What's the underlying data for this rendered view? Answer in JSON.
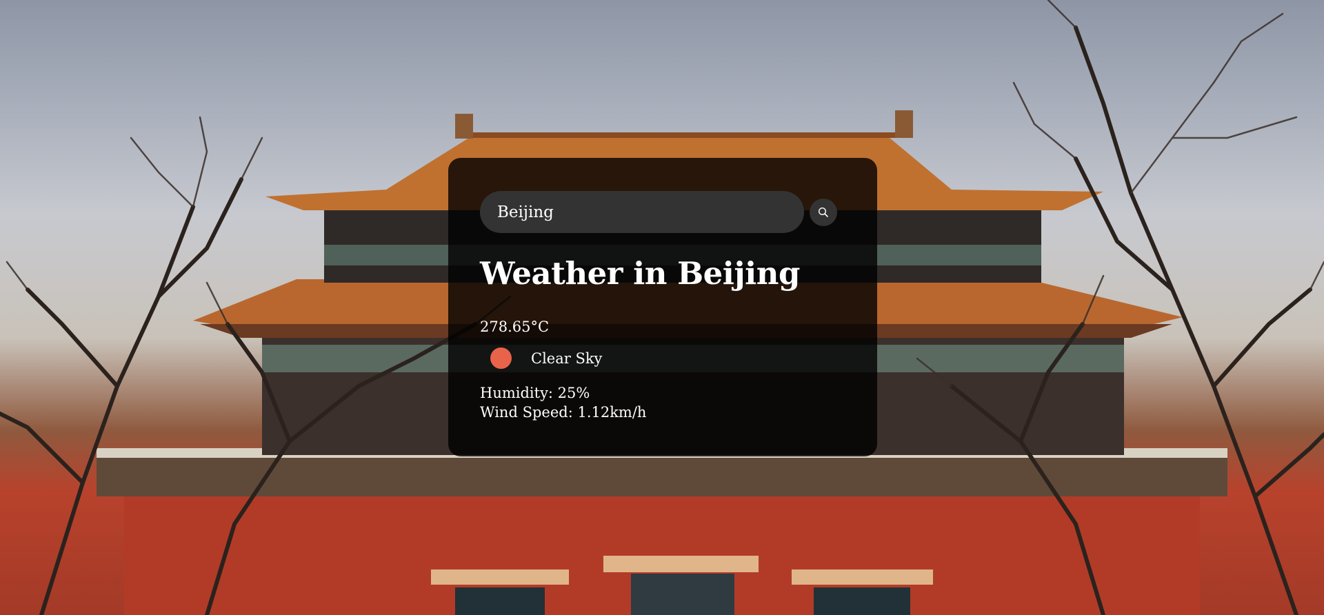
{
  "search": {
    "value": "Beijing",
    "placeholder": "Search"
  },
  "weather": {
    "title": "Weather in Beijing",
    "temperature": "278.65°C",
    "condition": "Clear Sky",
    "condition_icon": "sun-icon",
    "humidity": "Humidity: 25%",
    "wind_speed": "Wind Speed: 1.12km/h"
  },
  "colors": {
    "card_background": "rgba(0,0,0,0.8)",
    "input_background": "#333333",
    "text": "#ffffff",
    "sun": "#e8634a"
  },
  "background": {
    "scene": "palace-gate-with-bare-trees"
  }
}
